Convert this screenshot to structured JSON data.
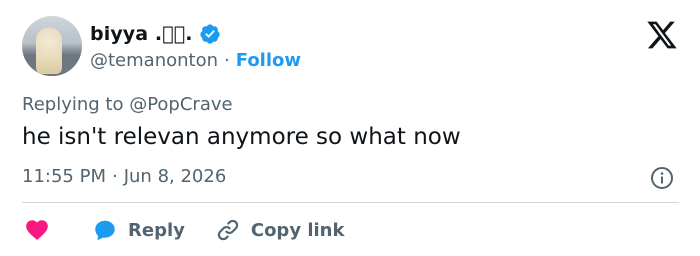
{
  "author": {
    "display_name": "biyya .\u0000\u0000.",
    "handle": "@temanonton",
    "follow_label": "Follow",
    "separator": "·"
  },
  "tweet": {
    "replying_to": "Replying to @PopCrave",
    "text": "he isn't relevan anymore so what now",
    "time": "11:55 PM",
    "separator": "·",
    "date": "Jun 8, 2026"
  },
  "actions": {
    "reply_label": "Reply",
    "copy_link_label": "Copy link"
  },
  "colors": {
    "accent": "#1d9bf0",
    "like": "#f91880",
    "muted": "#536471",
    "text": "#0f1419"
  },
  "icons": [
    "verified-badge-icon",
    "x-logo-icon",
    "info-icon",
    "heart-icon",
    "reply-bubble-icon",
    "link-icon"
  ]
}
